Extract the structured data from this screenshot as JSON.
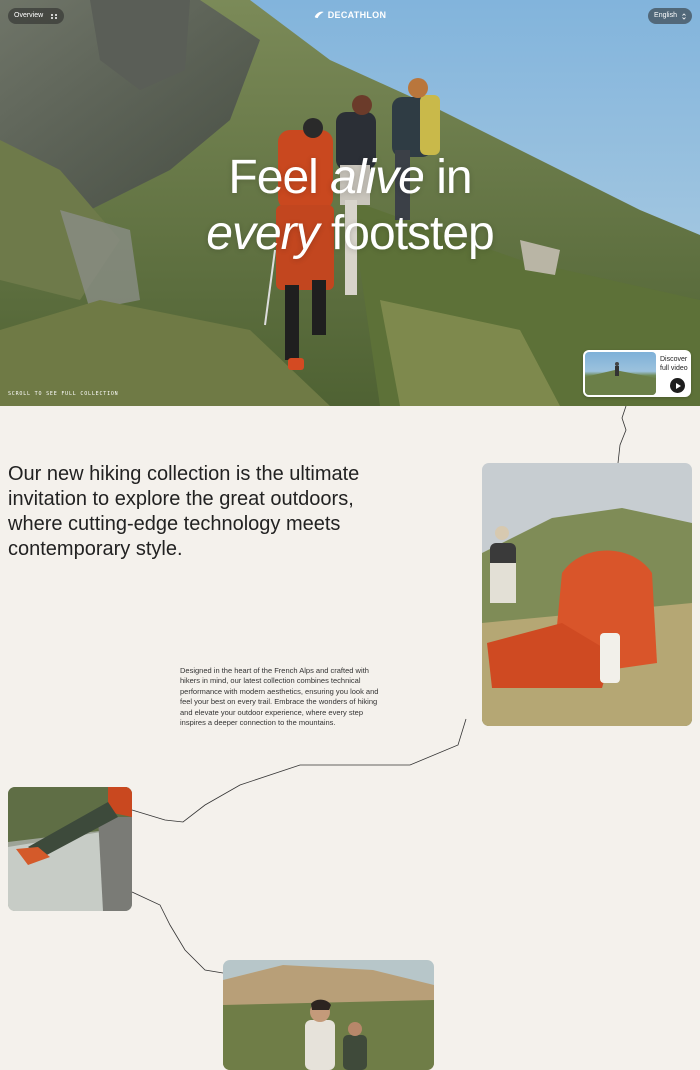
{
  "header": {
    "overview_label": "Overview",
    "brand": "DECATHLON",
    "language_label": "English"
  },
  "hero": {
    "title_line1_a": "Feel ",
    "title_line1_b": "alive",
    "title_line1_c": " in",
    "title_line2_a": "every",
    "title_line2_b": " footstep",
    "scroll_hint": "Scroll to see full collection"
  },
  "video_card": {
    "line1": "Discover",
    "line2": "full video"
  },
  "main": {
    "intro": "Our new hiking collection is the ultimate invitation to explore the great outdoors, where cutting-edge technology meets contemporary style.",
    "body": "Designed in the heart of the French Alps and crafted with hikers in mind, our latest collection combines technical performance with modern aesthetics, ensuring you look and feel your best on every trail. Embrace the wonders of hiking and elevate your outdoor experience, where every step inspires a deeper connection to the mountains."
  },
  "colors": {
    "background": "#f4f1ec",
    "text": "#1c1c1c",
    "accent_orange": "#d9552a"
  },
  "icons": [
    "grid-icon",
    "decathlon-logo-icon",
    "chevron-updown-icon",
    "play-icon"
  ]
}
